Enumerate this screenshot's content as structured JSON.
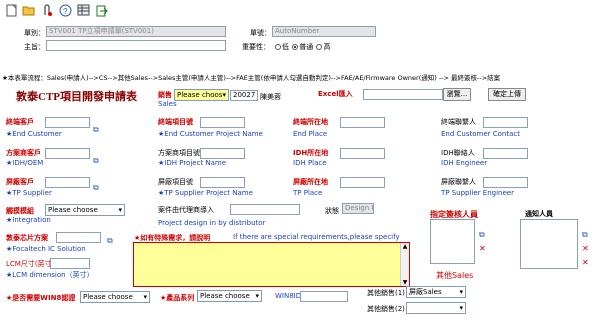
{
  "toolbar": {
    "icons": [
      "new-document-icon",
      "open-folder-icon",
      "attachment-icon",
      "help-icon",
      "grid-icon",
      "export-icon"
    ]
  },
  "header": {
    "form_label": "單別：",
    "form_value": "STV001 TP立項申請單(STV001)",
    "doc_no_label": "單號：",
    "doc_no_value": "AutoNumber",
    "subject_label": "主旨：",
    "priority_label": "重要性：",
    "priority_options": [
      "低",
      "普通",
      "高"
    ],
    "priority_selected": "普通"
  },
  "flow_text": "★本表單流程：Sales(申請人)-->CS-->其他Sales-->Sales主管(申請人主管)-->FAE主管(依申請人勾選自動判定)-->FAE/AE/Firmware Owner(通知) --> 最終簽核-->結案",
  "form": {
    "title": "敦泰CTP項目開發申請表",
    "sales_label": "銷售",
    "sales_select": "Please choos",
    "sales_id": "20027",
    "sales_name": "陳美蓉",
    "sales_en": "Sales",
    "excel_label": "Excel匯入",
    "browse_label": "瀏覽...",
    "upload_label": "確定上傳"
  },
  "rows": {
    "end_customer_label": "終端客戶",
    "end_customer_en": "★End Customer",
    "end_project_label": "終端項目號",
    "end_project_en": "★End Customer Project Name",
    "end_place_label": "終端所在地",
    "end_place_en": "End Place",
    "end_contact_label": "終端聯繫人",
    "end_contact_en": "End Customer Contact",
    "idh_label": "方案商客戶",
    "idh_en": "★IDH/OEM",
    "idh_project_label": "方案商項目號",
    "idh_project_en": "★IDH Project Name",
    "idh_place_label": "IDH所在地",
    "idh_place_en": "IDH Place",
    "idh_engineer_label": "IDH聯絡人",
    "idh_engineer_en": "IDH Engineer",
    "tp_supplier_label": "屏廠客戶",
    "tp_supplier_en": "★TP Supplier",
    "tp_project_label": "屏廠項目號",
    "tp_project_en": "★TP Supplier Project Name",
    "tp_place_label": "屏廠所在地",
    "tp_place_en": "TP Place",
    "tp_engineer_label": "屏廠聯繫人",
    "tp_engineer_en": "TP Supplier Engineer",
    "integration_label": "觸摸模組",
    "integration_select": "Please choose",
    "integration_en": "★Integration",
    "distributor_label": "案件由代理商導入",
    "distributor_en": "Project design in by distributor",
    "status_label": "狀態",
    "status_value": "Design In",
    "focaltech_label": "敦泰芯片方案",
    "focaltech_en": "★Focaltech IC Solution",
    "special_label": "★如有特殊需求，請說明",
    "special_en": "If there are special requirements,please specify",
    "lcm_label": "LCM尺寸(英寸)",
    "lcm_en": "★LCM dimension（英寸）",
    "approver_label": "指定簽核人員",
    "notify_label": "通知人員",
    "other_sales_label": "其他Sales",
    "win8_label": "★是否需要WIN8認證",
    "win8_select": "Please choose",
    "product_label": "★產品系列",
    "product_select": "Please choose",
    "win8id_label": "WIN8ID",
    "other_sales1_label": "其他銷售(1)",
    "other_sales1_select": "屏廠Sales",
    "other_sales2_label": "其他銷售(2)"
  }
}
